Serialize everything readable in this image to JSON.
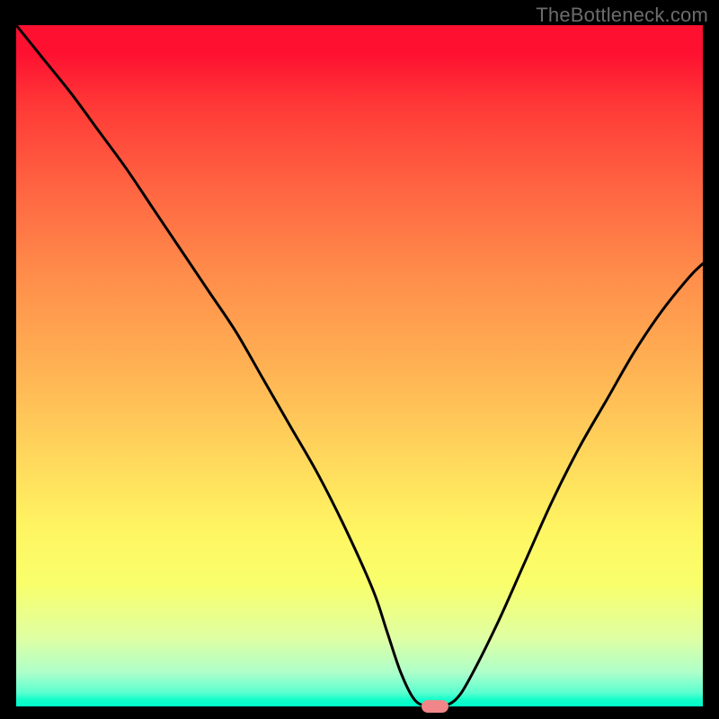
{
  "watermark": "TheBottleneck.com",
  "colors": {
    "background": "#000000",
    "curve_stroke": "#000000",
    "marker_fill": "#f08688",
    "watermark_text": "#6c6c6c"
  },
  "chart_data": {
    "type": "line",
    "title": "",
    "xlabel": "",
    "ylabel": "",
    "xlim": [
      0,
      100
    ],
    "ylim": [
      0,
      100
    ],
    "grid": false,
    "legend": null,
    "gradient_stops": [
      {
        "pos": 0.0,
        "color": "#fe1031"
      },
      {
        "pos": 0.24,
        "color": "#ff6542"
      },
      {
        "pos": 0.5,
        "color": "#ffb153"
      },
      {
        "pos": 0.74,
        "color": "#fff562"
      },
      {
        "pos": 0.9,
        "color": "#dfffa3"
      },
      {
        "pos": 1.0,
        "color": "#00fccb"
      }
    ],
    "series": [
      {
        "name": "bottleneck-curve",
        "x": [
          0.0,
          4,
          8,
          12,
          16,
          20,
          24,
          28,
          32,
          36,
          40,
          44,
          48,
          52,
          54,
          56,
          58,
          60,
          62,
          64,
          66,
          70,
          74,
          78,
          82,
          86,
          90,
          94,
          98,
          100
        ],
        "y": [
          100,
          95,
          90,
          84.5,
          79,
          73,
          67,
          61,
          55,
          48,
          41,
          34,
          26,
          17,
          11,
          5,
          1,
          0,
          0,
          1,
          4,
          12,
          21,
          30,
          38,
          45,
          52,
          58,
          63,
          65
        ]
      }
    ],
    "annotations": [
      {
        "name": "minimum-marker",
        "shape": "pill",
        "x": 61,
        "y": 0,
        "fill": "#f08688"
      }
    ]
  }
}
